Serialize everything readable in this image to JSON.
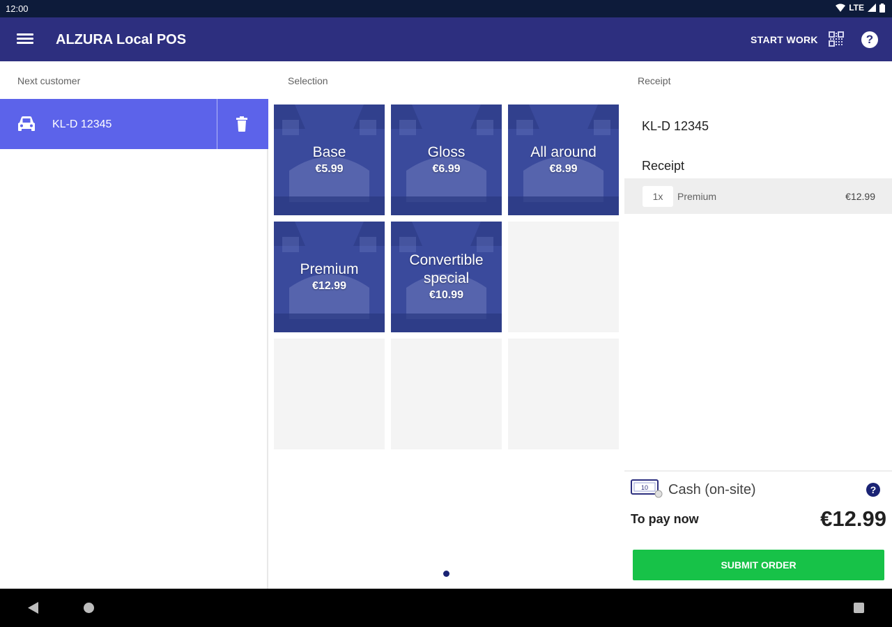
{
  "status_bar": {
    "time": "12:00",
    "network": "LTE"
  },
  "app_bar": {
    "title": "ALZURA Local POS",
    "start_work_label": "START WORK",
    "icons": [
      "menu-icon",
      "qr-code-icon",
      "help-icon"
    ]
  },
  "columns": {
    "next_customer": "Next customer",
    "selection": "Selection",
    "receipt": "Receipt"
  },
  "customer": {
    "plate": "KL-D 12345",
    "icons": [
      "car-icon",
      "trash-icon"
    ]
  },
  "selection": {
    "products": [
      {
        "name": "Base",
        "price": "€5.99"
      },
      {
        "name": "Gloss",
        "price": "€6.99"
      },
      {
        "name": "All around",
        "price": "€8.99"
      },
      {
        "name": "Premium",
        "price": "€12.99"
      },
      {
        "name": "Convertible special",
        "price": "€10.99"
      }
    ],
    "page_count": 1,
    "current_page": 1
  },
  "receipt": {
    "plate": "KL-D 12345",
    "title": "Receipt",
    "lines": [
      {
        "qty": "1x",
        "item": "Premium",
        "amount": "€12.99"
      }
    ]
  },
  "payment": {
    "method": "Cash (on-site)",
    "cash_icon_label": "10",
    "to_pay_label": "To pay now",
    "total": "€12.99",
    "submit_label": "SUBMIT ORDER"
  },
  "colors": {
    "status_bar": "#0d1b3a",
    "app_bar": "#2d2f7f",
    "selected_customer": "#5c63ea",
    "tile": "#3a4a9c",
    "submit": "#17c248",
    "accent_dark": "#1a2374"
  }
}
